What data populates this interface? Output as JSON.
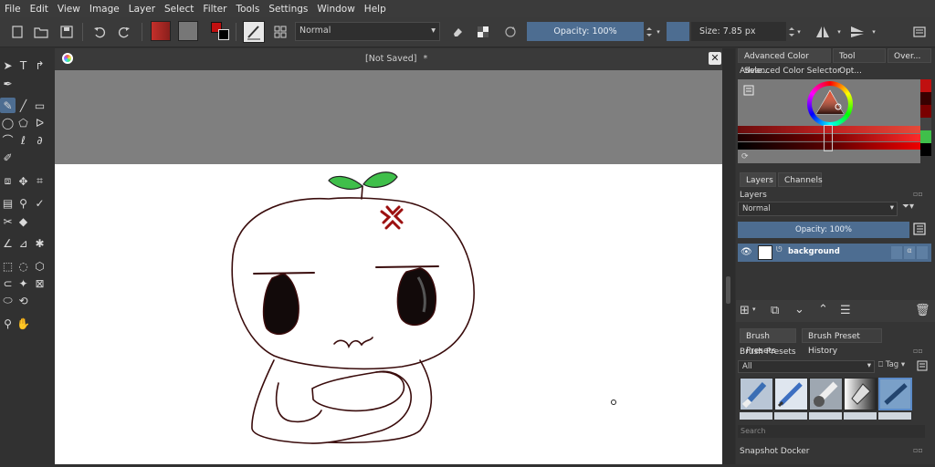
{
  "menubar": {
    "items": [
      "File",
      "Edit",
      "View",
      "Image",
      "Layer",
      "Select",
      "Filter",
      "Tools",
      "Settings",
      "Window",
      "Help"
    ]
  },
  "toolbar": {
    "blend_mode": "Normal",
    "opacity_label": "Opacity: 100%",
    "size_label": "Size: 7.85 px"
  },
  "document": {
    "title": "[Not Saved]",
    "modified_marker": "*"
  },
  "dock": {
    "tabs": [
      "Advanced Color Sele...",
      "Tool Opt...",
      "Over..."
    ],
    "color_selector_title": "Advanced Color Selector",
    "layer_tabs": [
      "Layers",
      "Channels"
    ],
    "layers_title": "Layers",
    "layers_blend_mode": "Normal",
    "layers_opacity": "Opacity: 100%",
    "layer_name": "background",
    "brush_tabs": [
      "Brush Presets",
      "Brush Preset History"
    ],
    "brush_presets_title": "Brush Presets",
    "brush_filter": "All",
    "tag_label": "Tag",
    "search_placeholder": "Search",
    "snapshot_title": "Snapshot Docker"
  },
  "colors": {
    "accent": "#4d6d91",
    "panel": "#353535",
    "canvas_bg": "#7f7f7f",
    "paper": "#ffffff",
    "sprout": "#3fbf4a"
  }
}
